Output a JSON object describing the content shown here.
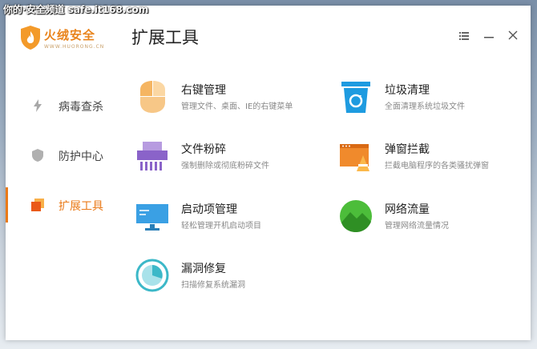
{
  "watermark": "你的·安全频道 safe.it168.com",
  "app": {
    "logo_text": "火绒安全",
    "logo_subtext": "WWW.HUORONG.CN",
    "page_title": "扩展工具"
  },
  "window_controls": {
    "menu_icon": "menu-icon",
    "minimize_icon": "minimize-icon",
    "close_icon": "close-icon"
  },
  "sidebar": {
    "items": [
      {
        "label": "病毒查杀",
        "icon": "lightning-icon",
        "active": false
      },
      {
        "label": "防护中心",
        "icon": "shield-icon",
        "active": false
      },
      {
        "label": "扩展工具",
        "icon": "tools-icon",
        "active": true
      }
    ]
  },
  "tools": [
    {
      "name": "右键管理",
      "desc": "管理文件、桌面、IE的右键菜单",
      "icon": "context-menu-icon"
    },
    {
      "name": "垃圾清理",
      "desc": "全面清理系统垃圾文件",
      "icon": "trash-icon"
    },
    {
      "name": "文件粉碎",
      "desc": "强制删除或彻底粉碎文件",
      "icon": "shredder-icon"
    },
    {
      "name": "弹窗拦截",
      "desc": "拦截电脑程序的各类骚扰弹窗",
      "icon": "popup-block-icon"
    },
    {
      "name": "启动项管理",
      "desc": "轻松管理开机启动项目",
      "icon": "startup-monitor-icon"
    },
    {
      "name": "网络流量",
      "desc": "管理网络流量情况",
      "icon": "network-traffic-icon"
    },
    {
      "name": "漏洞修复",
      "desc": "扫描修复系统漏洞",
      "icon": "vulnerability-fix-icon"
    }
  ],
  "colors": {
    "accent": "#ea7a18",
    "trash_blue": "#1e9be0",
    "shredder_purple": "#8a63c9",
    "popup_orange": "#f08a2c",
    "monitor_blue": "#3aa0e4",
    "network_green": "#4cbd3a",
    "vuln_teal": "#3cb8c8"
  }
}
